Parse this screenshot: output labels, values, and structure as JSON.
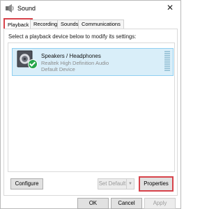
{
  "window": {
    "title": "Sound",
    "close_symbol": "✕"
  },
  "tabs": [
    "Playback",
    "Recording",
    "Sounds",
    "Communications"
  ],
  "playback": {
    "instruction": "Select a playback device below to modify its settings:",
    "device": {
      "name": "Speakers / Headphones",
      "driver": "Realtek High Definition Audio",
      "status": "Default Device",
      "icon": "speaker-icon",
      "status_icon": "default-checkmark-icon"
    },
    "buttons": {
      "configure": "Configure",
      "set_default": "Set Default",
      "set_default_arrow": "▼",
      "properties": "Properties"
    }
  },
  "footer": {
    "ok": "OK",
    "cancel": "Cancel",
    "apply": "Apply"
  },
  "colors": {
    "highlight": "#d7424a",
    "selection_bg": "#d9eef9",
    "check_green": "#26a64b"
  }
}
